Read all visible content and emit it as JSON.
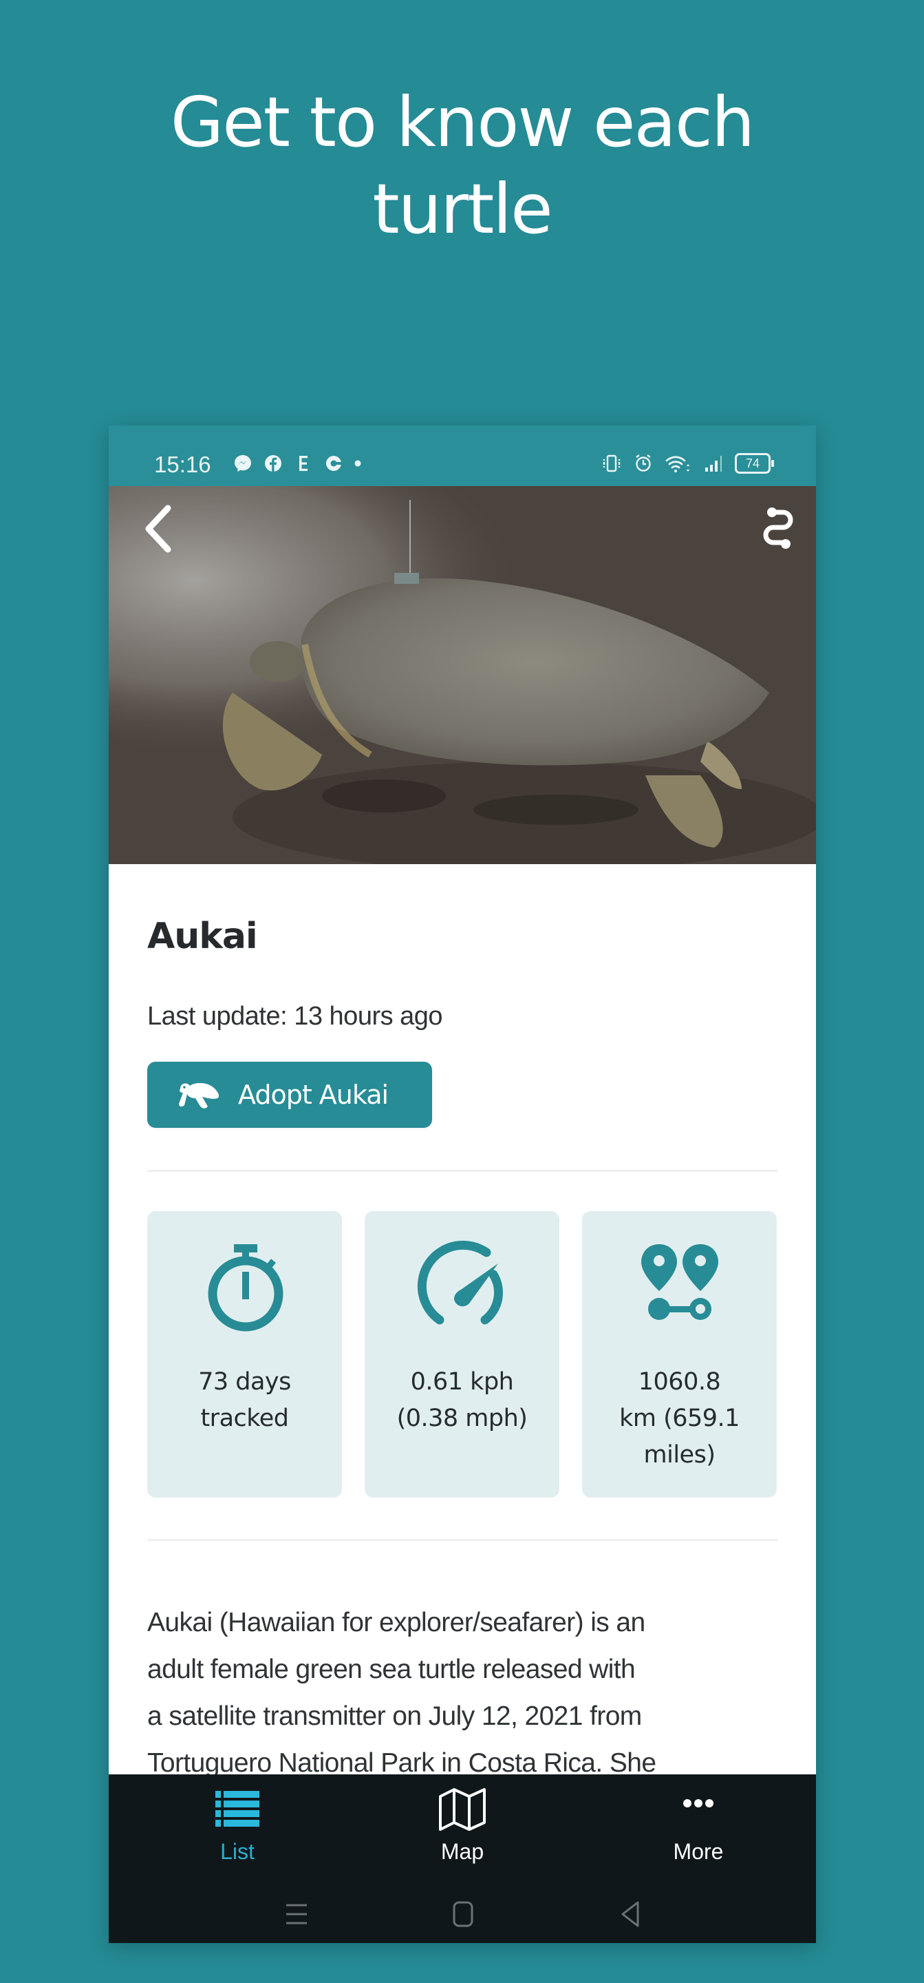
{
  "headline": {
    "line1": "Get to know each",
    "line2": "turtle"
  },
  "status_bar": {
    "time": "15:16",
    "left_icons": [
      "messenger-icon",
      "facebook-icon",
      "e-app-icon",
      "c-app-icon",
      "dot-icon"
    ],
    "right_icons": [
      "vibrate-icon",
      "alarm-icon",
      "wifi-icon",
      "signal-icon"
    ],
    "battery": "74"
  },
  "hero": {
    "back_icon": "chevron-left-icon",
    "route_icon": "route-icon",
    "image_alt": "Green sea turtle with satellite transmitter on a dark sand beach"
  },
  "turtle": {
    "name": "Aukai",
    "last_update": "Last update: 13 hours ago",
    "adopt_label": "Adopt Aukai"
  },
  "stats": [
    {
      "icon": "stopwatch-icon",
      "line1": "73 days",
      "line2": "tracked",
      "line3": ""
    },
    {
      "icon": "speedometer-icon",
      "line1": "0.61 kph",
      "line2": "(0.38 mph)",
      "line3": ""
    },
    {
      "icon": "distance-pins-icon",
      "line1": "1060.8",
      "line2": "km (659.1",
      "line3": "miles)"
    }
  ],
  "description": {
    "lines": [
      "Aukai (Hawaiian for explorer/seafarer) is an",
      "adult female green sea turtle released with",
      "a satellite transmitter on July 12, 2021 from",
      "Tortuguero National Park in Costa Rica. She"
    ]
  },
  "bottom_nav": {
    "tabs": [
      {
        "label": "List",
        "icon": "list-icon",
        "active": true
      },
      {
        "label": "Map",
        "icon": "map-icon",
        "active": false
      },
      {
        "label": "More",
        "icon": "more-dots-icon",
        "active": false
      }
    ],
    "system": [
      "recents-icon",
      "home-icon",
      "back-icon"
    ]
  },
  "colors": {
    "background": "#258b95",
    "accent": "#278c96",
    "card_bg": "#e1eeef",
    "nav_bg": "#0f171a",
    "nav_active": "#2aaed0"
  }
}
